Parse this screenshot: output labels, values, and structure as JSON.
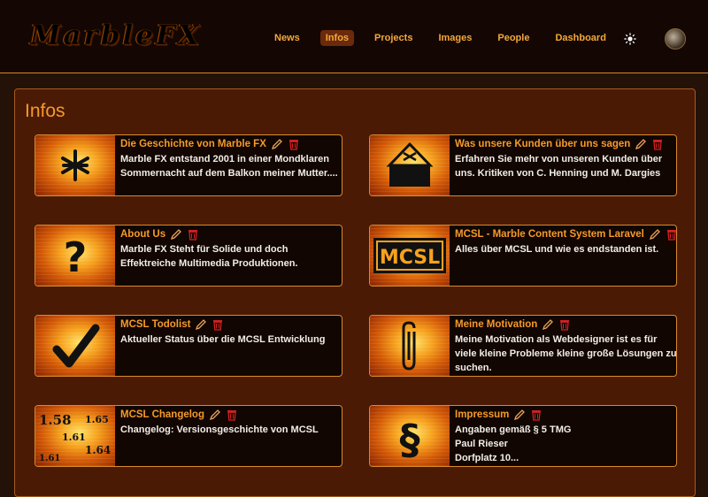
{
  "brand": {
    "logo_text": "MarbleFX"
  },
  "nav": {
    "items": [
      "News",
      "Infos",
      "Projects",
      "Images",
      "People",
      "Dashboard"
    ],
    "active": "Infos"
  },
  "icons": {
    "theme_toggle": "sun-icon",
    "user": "avatar"
  },
  "colors": {
    "accent": "#f59a2a",
    "card_border": "#d98a2a",
    "panel_bg": "#4b1a05",
    "delete": "#d42020"
  },
  "page": {
    "title": "Infos"
  },
  "cards": [
    {
      "title": "Die Geschichte von Marble FX",
      "icon": "asterisk-icon",
      "lines": [
        "Marble FX entstand 2001 in einer Mondklaren",
        "Sommernacht auf dem Balkon meiner Mutter...."
      ]
    },
    {
      "title": "Was unsere Kunden über uns sagen",
      "icon": "ballot-box-icon",
      "lines": [
        "Erfahren Sie mehr von unseren Kunden über",
        "uns. Kritiken von C. Henning und M. Dargies"
      ]
    },
    {
      "title": "About Us",
      "icon": "question-mark-icon",
      "lines": [
        "Marble FX Steht für Solide und doch",
        "Effektreiche Multimedia Produktionen."
      ]
    },
    {
      "title": "MCSL - Marble Content System Laravel",
      "icon": "mcsl-logo",
      "logo_text": "MCSL",
      "lines": [
        "Alles über MCSL und wie es endstanden ist."
      ]
    },
    {
      "title": "MCSL Todolist",
      "icon": "checkmark-icon",
      "lines": [
        "Aktueller Status über die MCSL Entwicklung"
      ]
    },
    {
      "title": "Meine Motivation",
      "icon": "paperclip-icon",
      "lines": [
        "Meine Motivation als Webdesigner ist es für",
        "viele kleine Probleme kleine große Lösungen zu",
        "suchen."
      ]
    },
    {
      "title": "MCSL Changelog",
      "icon": "version-numbers-icon",
      "version_numbers": [
        "1.58",
        "1.65",
        "1.61",
        "1.64",
        "1.61"
      ],
      "lines": [
        "Changelog: Versionsgeschichte von MCSL"
      ]
    },
    {
      "title": "Impressum",
      "icon": "paragraph-icon",
      "lines": [
        "Angaben gemäß § 5 TMG",
        "Paul Rieser",
        "Dorfplatz 10..."
      ]
    }
  ]
}
